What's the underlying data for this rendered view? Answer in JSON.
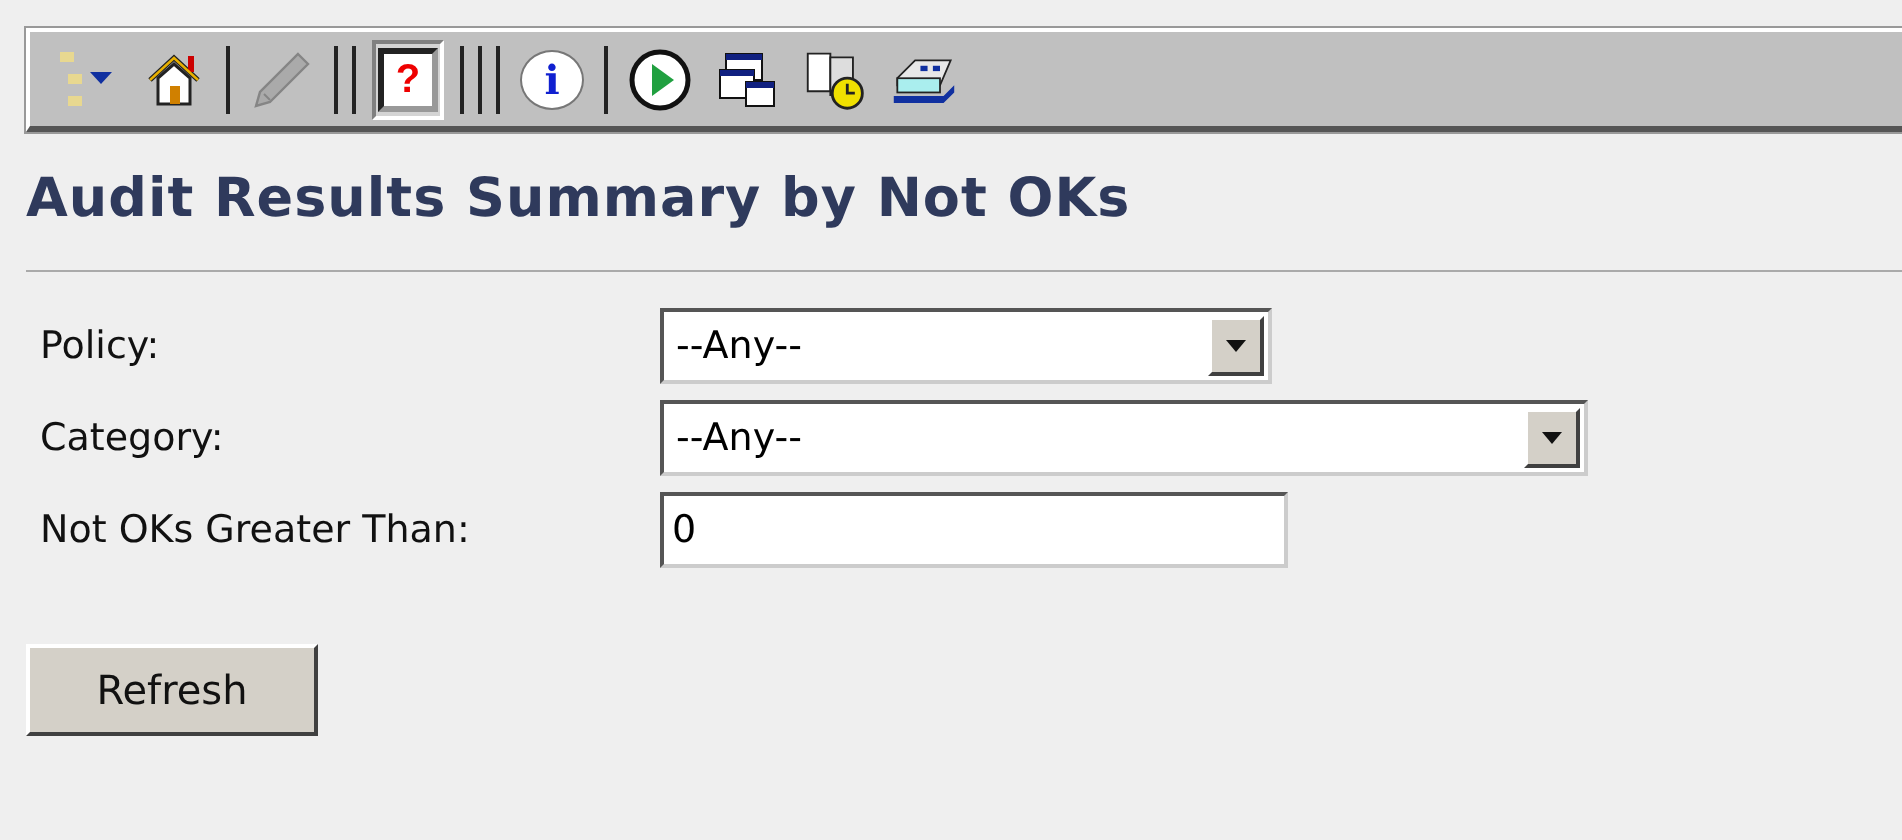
{
  "toolbar": [
    {
      "kind": "tree",
      "disabled": false,
      "pressed": false
    },
    {
      "kind": "home",
      "disabled": false,
      "pressed": false
    },
    {
      "kind": "separator"
    },
    {
      "kind": "pencil",
      "disabled": true,
      "pressed": false
    },
    {
      "kind": "double-separator"
    },
    {
      "kind": "help",
      "glyph": "?",
      "disabled": false,
      "pressed": true
    },
    {
      "kind": "triple-separator"
    },
    {
      "kind": "info",
      "glyph": "i",
      "disabled": false,
      "pressed": false
    },
    {
      "kind": "separator"
    },
    {
      "kind": "play",
      "disabled": false,
      "pressed": false
    },
    {
      "kind": "windows",
      "disabled": false,
      "pressed": false
    },
    {
      "kind": "bookclock",
      "disabled": false,
      "pressed": false
    },
    {
      "kind": "device",
      "disabled": false,
      "pressed": false
    }
  ],
  "page_title": "Audit Results Summary by Not OKs",
  "fields": [
    {
      "kind": "select",
      "label": "Policy:",
      "value": "--Any--"
    },
    {
      "kind": "wide-select",
      "label": "Category:",
      "value": "--Any--"
    },
    {
      "kind": "text",
      "label": "Not OKs Greater Than:",
      "value": "0"
    }
  ],
  "buttons": [
    "Refresh"
  ]
}
